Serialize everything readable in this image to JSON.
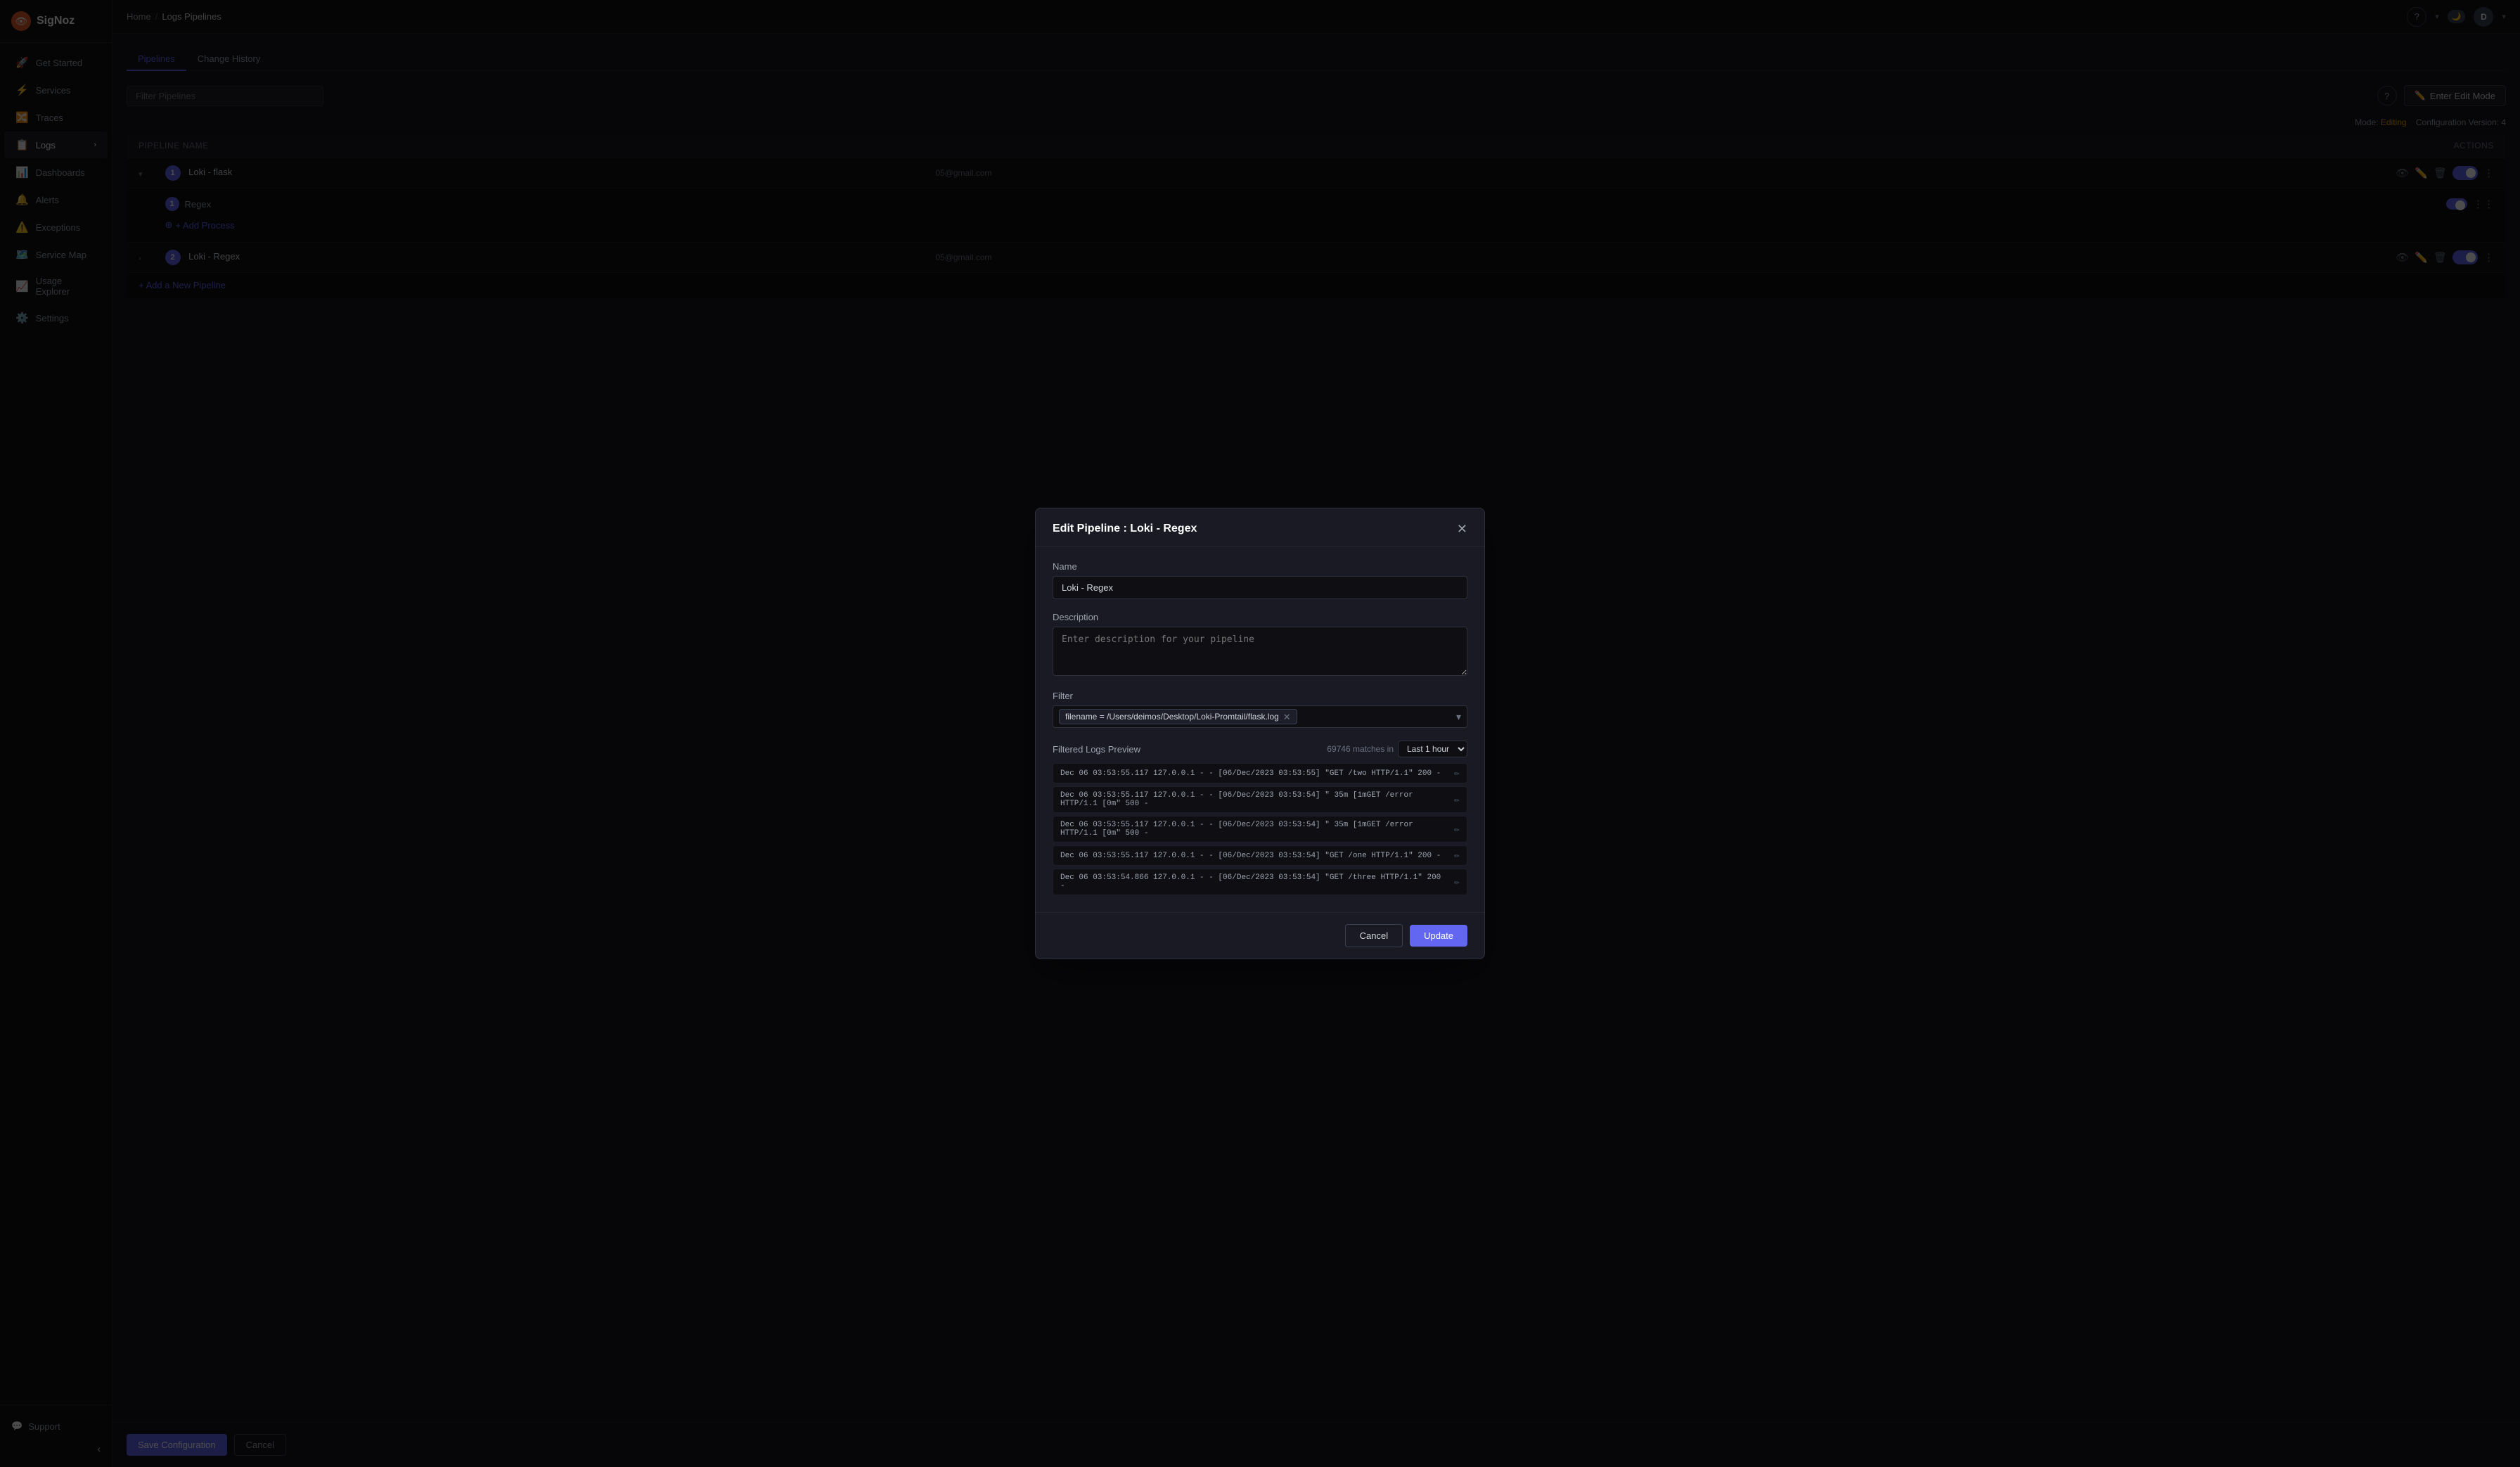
{
  "app": {
    "name": "SigNoz"
  },
  "sidebar": {
    "items": [
      {
        "id": "get-started",
        "label": "Get Started",
        "icon": "🚀"
      },
      {
        "id": "services",
        "label": "Services",
        "icon": "⚡"
      },
      {
        "id": "traces",
        "label": "Traces",
        "icon": "🔀"
      },
      {
        "id": "logs",
        "label": "Logs",
        "icon": "📋",
        "hasExpand": true
      },
      {
        "id": "dashboards",
        "label": "Dashboards",
        "icon": "📊"
      },
      {
        "id": "alerts",
        "label": "Alerts",
        "icon": "🔔"
      },
      {
        "id": "exceptions",
        "label": "Exceptions",
        "icon": "⚠️"
      },
      {
        "id": "service-map",
        "label": "Service Map",
        "icon": "🗺️"
      },
      {
        "id": "usage-explorer",
        "label": "Usage Explorer",
        "icon": "📈"
      },
      {
        "id": "settings",
        "label": "Settings",
        "icon": "⚙️"
      }
    ],
    "support": "Support",
    "collapse_icon": "‹"
  },
  "topbar": {
    "breadcrumb": {
      "home": "Home",
      "separator": "/",
      "current": "Logs Pipelines"
    },
    "help_icon": "?",
    "user_initial": "D"
  },
  "tabs": [
    {
      "id": "pipelines",
      "label": "Pipelines",
      "active": true
    },
    {
      "id": "change-history",
      "label": "Change History",
      "active": false
    }
  ],
  "page": {
    "filter_placeholder": "Filter Pipelines",
    "edit_mode_btn": "Enter Edit Mode",
    "mode_label": "Mode:",
    "mode_value": "Editing",
    "config_label": "Configuration Version:",
    "config_version": "4"
  },
  "table": {
    "columns": [
      "Pipeline Name",
      "",
      "",
      "Actions"
    ],
    "rows": [
      {
        "id": 1,
        "num": "1",
        "name": "Loki - flask",
        "expanded": true,
        "email": "05@gmail.com",
        "enabled": true,
        "sub_rows": [
          {
            "num": "1",
            "name": "Regex"
          }
        ]
      },
      {
        "id": 2,
        "num": "2",
        "name": "Loki - Regex",
        "expanded": false,
        "email": "05@gmail.com",
        "enabled": true
      }
    ],
    "add_pipeline_label": "+ Add a New Pipeline",
    "add_process_label": "+ Add Process"
  },
  "bottom_actions": {
    "save_label": "Save Configuration",
    "cancel_label": "Cancel"
  },
  "modal": {
    "title": "Edit Pipeline : Loki - Regex",
    "name_label": "Name",
    "name_value": "Loki - Regex",
    "description_label": "Description",
    "description_placeholder": "Enter description for your pipeline",
    "filter_label": "Filter",
    "filter_tag": "filename = /Users/deimos/Desktop/Loki-Promtail/flask.log",
    "preview_label": "Filtered Logs Preview",
    "matches_count": "69746 matches in",
    "time_range": "Last 1 hour",
    "logs": [
      {
        "text": "Dec 06 03:53:55.117   127.0.0.1 - - [06/Dec/2023 03:53:55] \"GET /two HTTP/1.1\" 200 -"
      },
      {
        "text": "Dec 06 03:53:55.117   127.0.0.1 - - [06/Dec/2023 03:53:54] \" 35m [1mGET /error HTTP/1.1 [0m\" 500 -"
      },
      {
        "text": "Dec 06 03:53:55.117   127.0.0.1 - - [06/Dec/2023 03:53:54] \" 35m [1mGET /error HTTP/1.1 [0m\" 500 -"
      },
      {
        "text": "Dec 06 03:53:55.117   127.0.0.1 - - [06/Dec/2023 03:53:54] \"GET /one HTTP/1.1\" 200 -"
      },
      {
        "text": "Dec 06 03:53:54.866   127.0.0.1 - - [06/Dec/2023 03:53:54] \"GET /three HTTP/1.1\" 200 -"
      }
    ],
    "cancel_label": "Cancel",
    "update_label": "Update"
  }
}
